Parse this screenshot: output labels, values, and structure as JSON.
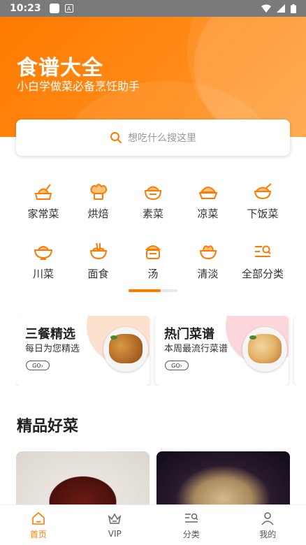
{
  "status_bar": {
    "time": "10:23"
  },
  "hero": {
    "title": "食谱大全",
    "subtitle": "小白学做菜必备烹饪助手"
  },
  "search": {
    "placeholder": "想吃什么搜这里"
  },
  "categories": [
    {
      "label": "家常菜",
      "icon": "home-cooking-icon"
    },
    {
      "label": "烘焙",
      "icon": "chef-hat-icon"
    },
    {
      "label": "素菜",
      "icon": "vegetable-dish-icon"
    },
    {
      "label": "凉菜",
      "icon": "cold-dish-icon"
    },
    {
      "label": "下饭菜",
      "icon": "rice-dish-icon"
    },
    {
      "label": "川菜",
      "icon": "sichuan-bowl-icon"
    },
    {
      "label": "面食",
      "icon": "noodle-bowl-icon"
    },
    {
      "label": "汤",
      "icon": "soup-pot-icon"
    },
    {
      "label": "清淡",
      "icon": "light-dish-icon"
    },
    {
      "label": "全部分类",
      "icon": "all-categories-icon"
    }
  ],
  "cards": [
    {
      "title": "三餐精选",
      "desc": "每日为您精选",
      "go": "GO"
    },
    {
      "title": "热门菜谱",
      "desc": "本周最流行菜谱",
      "go": "GO"
    }
  ],
  "section": {
    "title": "精品好菜"
  },
  "tabs": [
    {
      "label": "首页",
      "icon": "home-icon"
    },
    {
      "label": "VIP",
      "icon": "crown-icon"
    },
    {
      "label": "分类",
      "icon": "category-search-icon"
    },
    {
      "label": "我的",
      "icon": "user-icon"
    }
  ],
  "colors": {
    "accent": "#ff7a00"
  }
}
